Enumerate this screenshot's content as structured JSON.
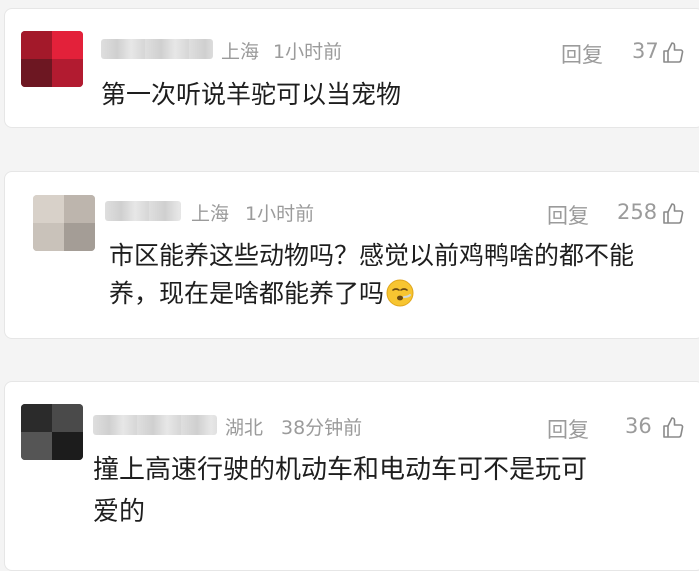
{
  "comments": [
    {
      "location": "上海",
      "time": "1小时前",
      "reply_label": "回复",
      "likes": "37",
      "text": "第一次听说羊驼可以当宠物"
    },
    {
      "location": "上海",
      "time": "1小时前",
      "reply_label": "回复",
      "likes": "258",
      "text_line1": "市区能养这些动物吗？感觉以前鸡鸭啥的都不能",
      "text_line2": "养，现在是啥都能养了吗",
      "emoji": "face-exhaling-emoji"
    },
    {
      "location": "湖北",
      "time": "38分钟前",
      "reply_label": "回复",
      "likes": "36",
      "text_line1": "撞上高速行驶的机动车和电动车可不是玩可",
      "text_line2": "爱的"
    }
  ],
  "icons": {
    "like": "thumbs-up-icon"
  },
  "colors": {
    "meta_text": "#9b9b9b",
    "body_text": "#1e1e1e",
    "card_bg": "#ffffff",
    "page_bg": "#f4f4f4"
  }
}
